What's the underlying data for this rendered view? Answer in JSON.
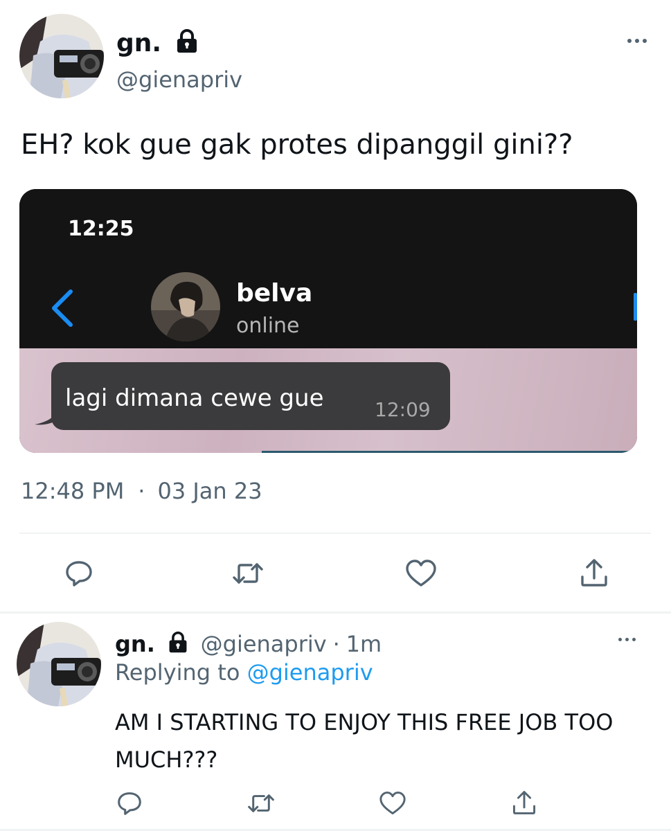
{
  "main_tweet": {
    "display_name": "gn.",
    "handle": "@gienapriv",
    "text": "EH? kok gue gak protes dipanggil gini??",
    "time": "12:48 PM",
    "separator": "·",
    "date": "03 Jan 23"
  },
  "embedded_screenshot": {
    "status_time": "12:25",
    "contact_name": "belva",
    "contact_status": "online",
    "message_text": "lagi dimana cewe gue",
    "message_time": "12:09"
  },
  "reply_tweet": {
    "display_name": "gn.",
    "handle": "@gienapriv",
    "separator": "·",
    "age": "1m",
    "replying_prefix": "Replying to",
    "replying_to": "@gienapriv",
    "text": "AM I STARTING TO ENJOY THIS FREE JOB TOO MUCH???"
  },
  "icons": {
    "lock": "lock-icon",
    "more": "more-icon",
    "reply": "reply-icon",
    "retweet": "retweet-icon",
    "like": "heart-icon",
    "share": "share-icon",
    "back": "chevron-left-icon"
  },
  "colors": {
    "text": "#0f1419",
    "secondary": "#536471",
    "link": "#1d9bf0",
    "divider": "#eff3f4"
  }
}
